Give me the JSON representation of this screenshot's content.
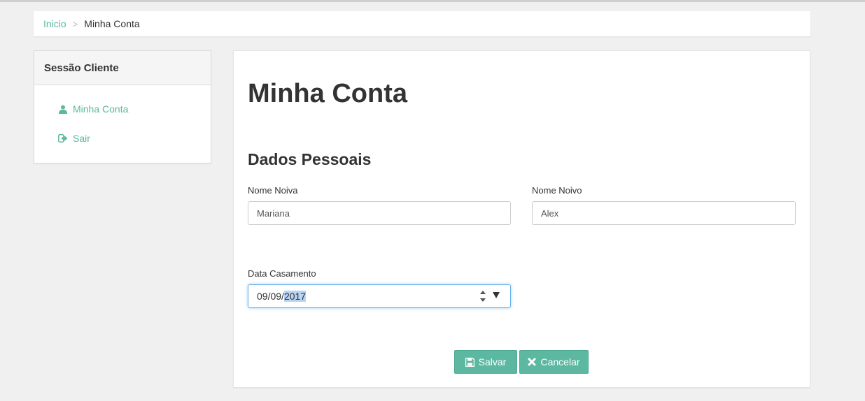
{
  "breadcrumb": {
    "home": "Inicio",
    "separator": ">",
    "current": "Minha Conta"
  },
  "sidebar": {
    "title": "Sessão Cliente",
    "items": [
      {
        "label": "Minha Conta",
        "icon": "user-icon"
      },
      {
        "label": "Sair",
        "icon": "sign-out-icon"
      }
    ]
  },
  "main": {
    "title": "Minha Conta",
    "section": "Dados Pessoais",
    "fields": {
      "bride": {
        "label": "Nome Noiva",
        "value": "Mariana"
      },
      "groom": {
        "label": "Nome Noivo",
        "value": "Alex"
      },
      "wedding_date": {
        "label": "Data Casamento",
        "day_month": "09/09/",
        "year": "2017"
      }
    },
    "buttons": {
      "save": "Salvar",
      "cancel": "Cancelar"
    }
  },
  "colors": {
    "accent": "#5cb8a0",
    "focus": "#66afe9",
    "background": "#f0f0f0"
  }
}
